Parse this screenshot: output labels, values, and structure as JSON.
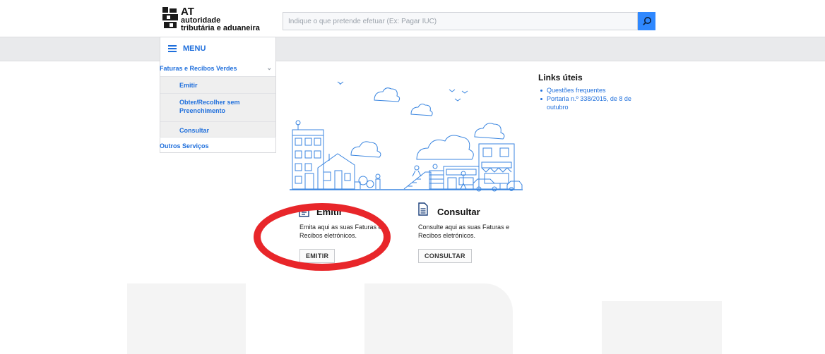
{
  "header": {
    "logo": {
      "at": "AT",
      "line1": "autoridade",
      "line2": "tributária e aduaneira"
    },
    "search": {
      "placeholder": "Indique o que pretende efetuar (Ex: Pagar IUC)",
      "value": ""
    },
    "search_icon": "search-icon"
  },
  "sidebar": {
    "menu_label": "MENU",
    "section": "Faturas e Recibos Verdes",
    "items": [
      {
        "label": "Emitir"
      },
      {
        "label": "Obter/Recolher sem Preenchimento"
      },
      {
        "label": "Consultar"
      }
    ],
    "other": "Outros Serviços"
  },
  "cards": {
    "emitir": {
      "title": "Emitir",
      "desc": "Emita aqui as suas Faturas e Recibos eletrónicos.",
      "button": "EMITIR",
      "icon": "document-icon"
    },
    "consultar": {
      "title": "Consultar",
      "desc": "Consulte aqui as suas Faturas e Recibos eletrónicos.",
      "button": "CONSULTAR",
      "icon": "document-icon"
    }
  },
  "links": {
    "title": "Links úteis",
    "items": [
      {
        "label": "Questões frequentes"
      },
      {
        "label": "Portaria n.º 338/2015, de 8 de outubro"
      }
    ]
  },
  "colors": {
    "accent": "#1f6fdc",
    "search_button": "#2f88ff",
    "annotation": "#e8262a"
  }
}
